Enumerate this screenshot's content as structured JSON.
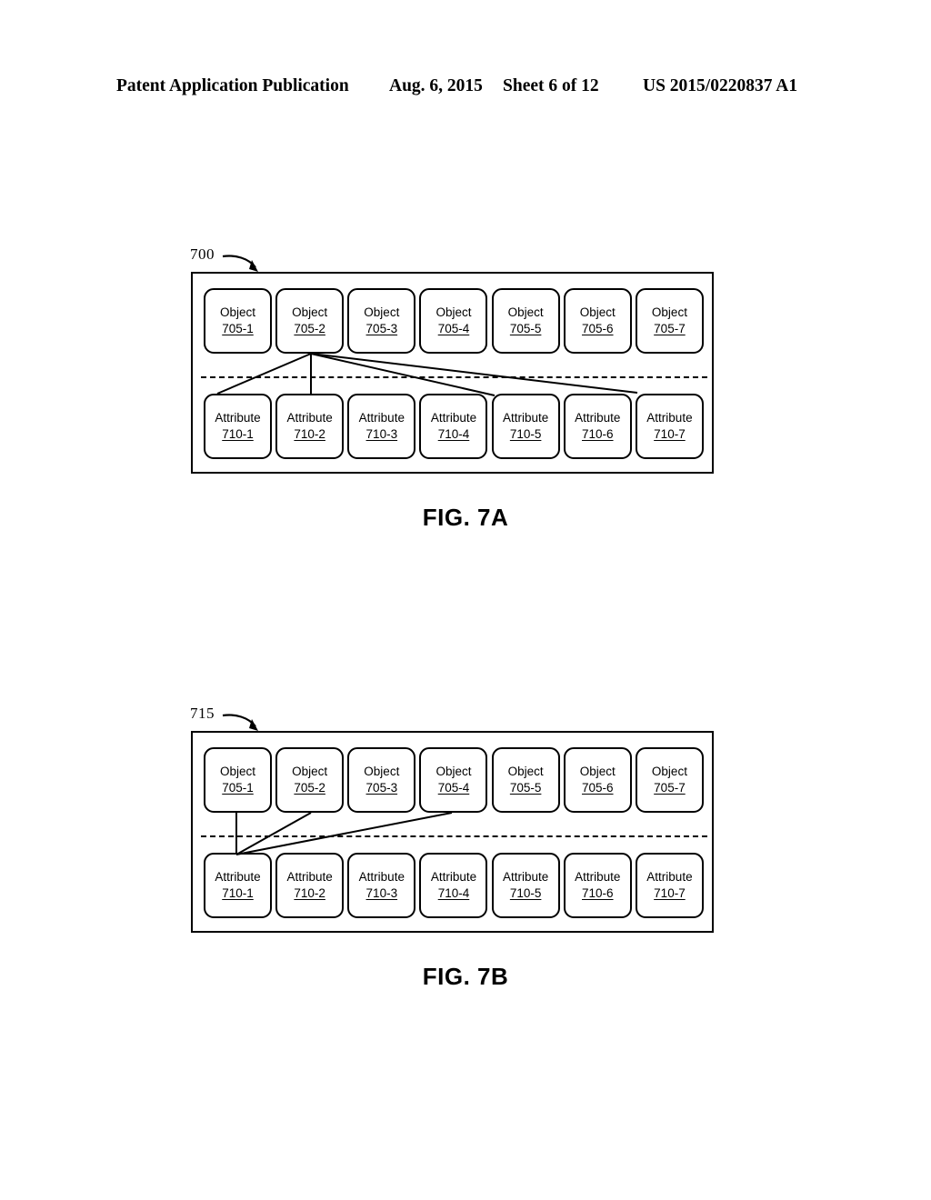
{
  "header": {
    "publication": "Patent Application Publication",
    "date": "Aug. 6, 2015",
    "sheet": "Sheet 6 of 12",
    "doc_number": "US 2015/0220837 A1"
  },
  "figures": [
    {
      "ref": "700",
      "caption": "FIG. 7A",
      "objects": [
        {
          "title": "Object",
          "id": "705-1"
        },
        {
          "title": "Object",
          "id": "705-2"
        },
        {
          "title": "Object",
          "id": "705-3"
        },
        {
          "title": "Object",
          "id": "705-4"
        },
        {
          "title": "Object",
          "id": "705-5"
        },
        {
          "title": "Object",
          "id": "705-6"
        },
        {
          "title": "Object",
          "id": "705-7"
        }
      ],
      "attributes": [
        {
          "title": "Attribute",
          "id": "710-1"
        },
        {
          "title": "Attribute",
          "id": "710-2"
        },
        {
          "title": "Attribute",
          "id": "710-3"
        },
        {
          "title": "Attribute",
          "id": "710-4"
        },
        {
          "title": "Attribute",
          "id": "710-5"
        },
        {
          "title": "Attribute",
          "id": "710-6"
        },
        {
          "title": "Attribute",
          "id": "710-7"
        }
      ],
      "connections": [
        {
          "from": "705-2",
          "to": "710-1"
        },
        {
          "from": "705-2",
          "to": "710-2"
        },
        {
          "from": "705-2",
          "to": "710-5"
        },
        {
          "from": "705-2",
          "to": "710-7"
        }
      ]
    },
    {
      "ref": "715",
      "caption": "FIG. 7B",
      "objects": [
        {
          "title": "Object",
          "id": "705-1"
        },
        {
          "title": "Object",
          "id": "705-2"
        },
        {
          "title": "Object",
          "id": "705-3"
        },
        {
          "title": "Object",
          "id": "705-4"
        },
        {
          "title": "Object",
          "id": "705-5"
        },
        {
          "title": "Object",
          "id": "705-6"
        },
        {
          "title": "Object",
          "id": "705-7"
        }
      ],
      "attributes": [
        {
          "title": "Attribute",
          "id": "710-1"
        },
        {
          "title": "Attribute",
          "id": "710-2"
        },
        {
          "title": "Attribute",
          "id": "710-3"
        },
        {
          "title": "Attribute",
          "id": "710-4"
        },
        {
          "title": "Attribute",
          "id": "710-5"
        },
        {
          "title": "Attribute",
          "id": "710-6"
        },
        {
          "title": "Attribute",
          "id": "710-7"
        }
      ],
      "connections": [
        {
          "from": "705-1",
          "to": "710-1"
        },
        {
          "from": "705-2",
          "to": "710-1"
        },
        {
          "from": "705-4",
          "to": "710-1"
        }
      ]
    }
  ]
}
